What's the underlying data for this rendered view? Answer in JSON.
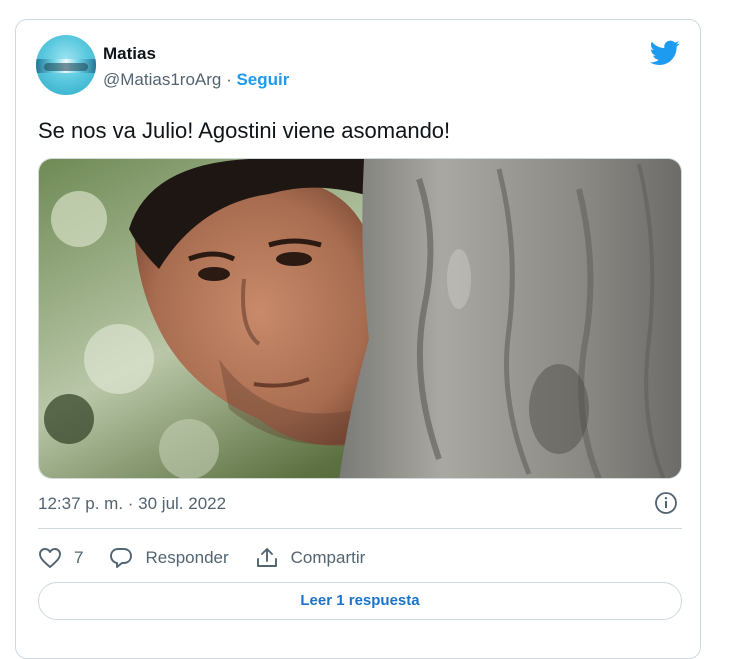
{
  "tweet": {
    "author": {
      "display_name": "Matias",
      "handle": "@Matias1roArg",
      "separator": " · ",
      "follow_label": "Seguir",
      "avatar_icon": "avatar-image"
    },
    "brand_icon": "twitter-bird-icon",
    "text": "Se nos va Julio! Agostini viene asomando!",
    "media": {
      "description_icon": "photo",
      "alt": ""
    },
    "timestamp": "12:37 p. m. · 30 jul. 2022",
    "info_icon": "info-icon",
    "actions": {
      "like": {
        "icon": "heart-icon",
        "count": "7"
      },
      "reply": {
        "icon": "speech-bubble-icon",
        "label": "Responder"
      },
      "share": {
        "icon": "share-upload-icon",
        "label": "Compartir"
      }
    },
    "read_replies_label": "Leer 1 respuesta"
  },
  "colors": {
    "accent": "#1d9bf0",
    "text_primary": "#0f1419",
    "text_secondary": "#536471",
    "border": "#cfd9de"
  }
}
